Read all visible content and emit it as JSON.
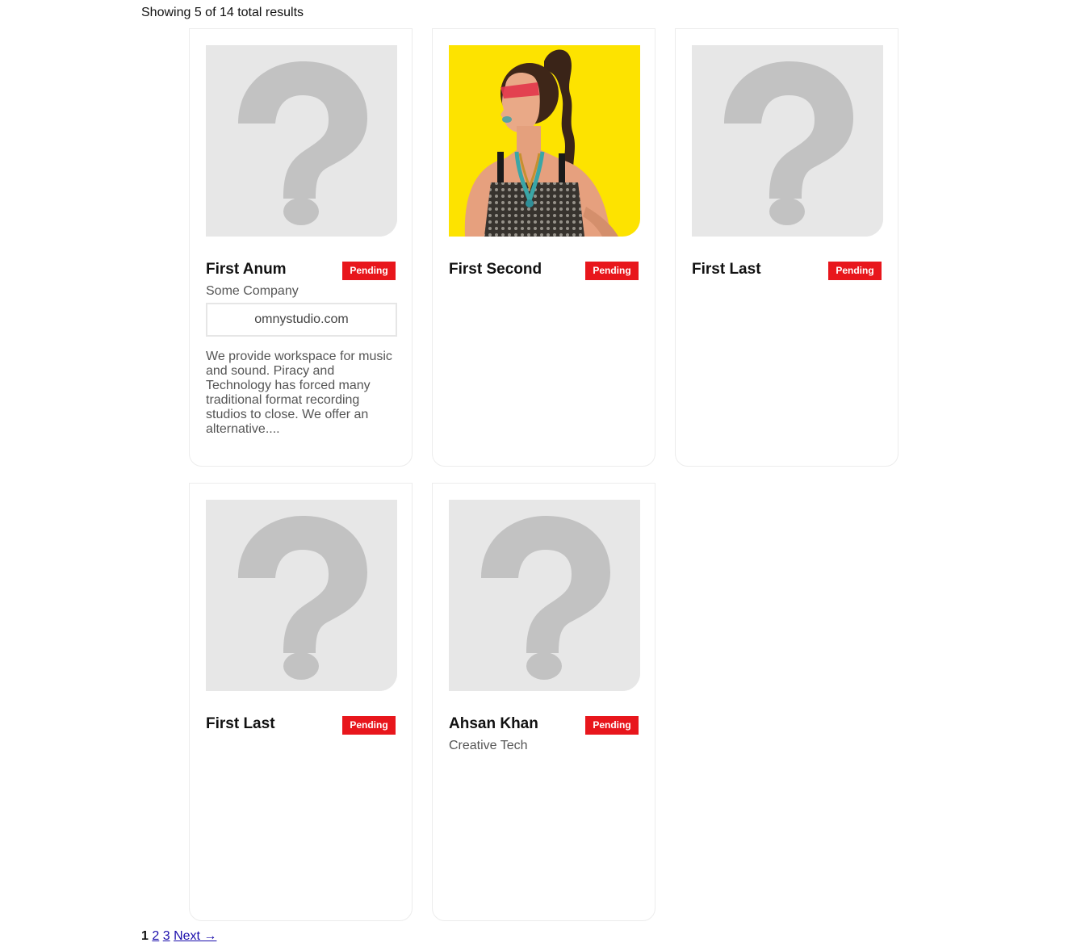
{
  "results": {
    "summary": "Showing 5 of 14 total results"
  },
  "cards": [
    {
      "name": "First Anum",
      "status": "Pending",
      "company": "Some Company",
      "website": "omnystudio.com",
      "description": "We provide workspace for music and sound. Piracy and Technology has forced many traditional format recording studios to close. We offer an alternative...."
    },
    {
      "name": "First Second",
      "status": "Pending"
    },
    {
      "name": "First Last",
      "status": "Pending"
    },
    {
      "name": "First Last",
      "status": "Pending"
    },
    {
      "name": "Ahsan Khan",
      "status": "Pending",
      "company": "Creative Tech"
    }
  ],
  "pagination": {
    "current": "1",
    "pages": [
      "2",
      "3"
    ],
    "next": "Next →"
  },
  "colors": {
    "badge": "#e8161c",
    "placeholder_bg": "#e7e7e7",
    "placeholder_glyph": "#c2c2c2",
    "photo_bg": "#fde300"
  },
  "icons": {
    "placeholder": "question-mark-icon"
  }
}
